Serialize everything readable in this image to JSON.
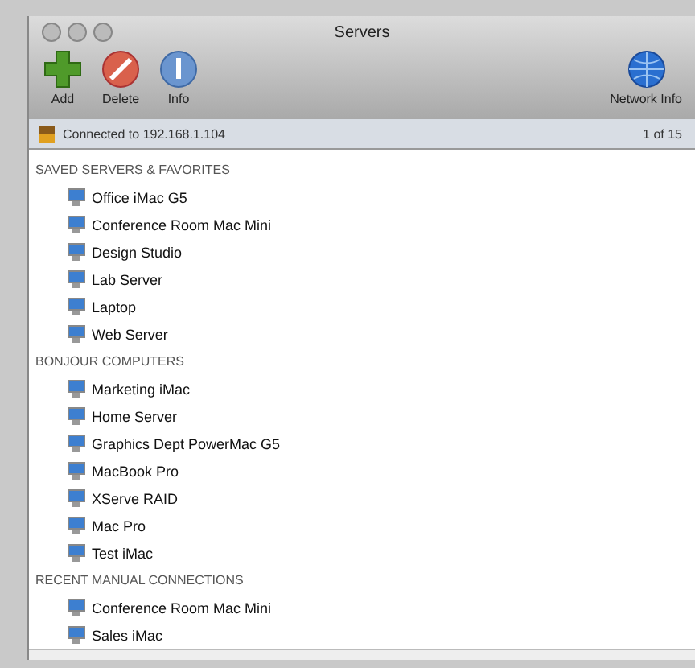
{
  "window": {
    "title": "Servers"
  },
  "toolbar": {
    "left": [
      {
        "label": "Add",
        "kind": "add"
      },
      {
        "label": "Delete",
        "kind": "delete"
      },
      {
        "label": "Info",
        "kind": "info"
      }
    ],
    "right": [
      {
        "label": "Network Info",
        "kind": "globe"
      }
    ]
  },
  "status_bar": {
    "text": "Connected to 192.168.1.104",
    "count": "1 of 15"
  },
  "sections": [
    {
      "title": "SAVED SERVERS & FAVORITES",
      "items": [
        "Office iMac G5",
        "Conference Room Mac Mini",
        "Design Studio",
        "Lab Server",
        "Laptop",
        "Web Server"
      ]
    },
    {
      "title": "BONJOUR COMPUTERS",
      "items": [
        "Marketing iMac",
        "Home Server",
        "Graphics Dept PowerMac G5",
        "MacBook Pro",
        "XServe RAID",
        "Mac Pro",
        "Test iMac"
      ]
    },
    {
      "title": "RECENT MANUAL CONNECTIONS",
      "items": [
        "Conference Room Mac Mini",
        "Sales iMac"
      ]
    }
  ]
}
